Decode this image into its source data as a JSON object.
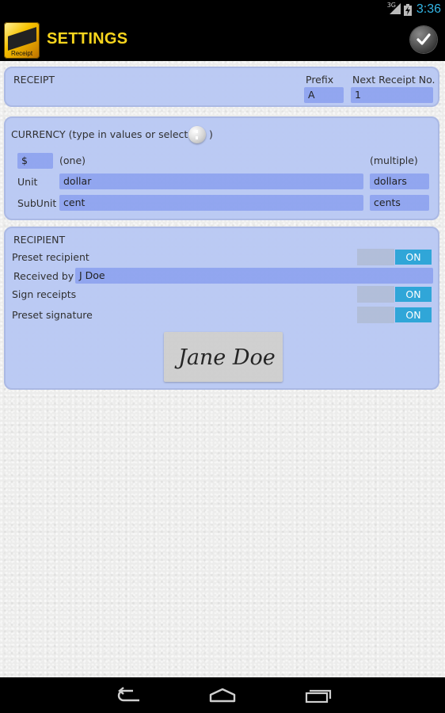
{
  "status_bar": {
    "network_type": "3G",
    "time": "3:36",
    "icons": [
      "signal-icon",
      "battery-charging-icon"
    ]
  },
  "action_bar": {
    "title": "SETTINGS",
    "app_icon_text": "Receipt",
    "done_icon": "check-icon"
  },
  "receipt_section": {
    "heading": "RECEIPT",
    "prefix_label": "Prefix",
    "prefix_value": "A",
    "next_number_label": "Next Receipt No.",
    "next_number_value": "1"
  },
  "currency_section": {
    "heading_prefix": "CURRENCY (type in values or select",
    "heading_suffix": ")",
    "select_icon": "more-options-icon",
    "symbol_value": "$",
    "one_label": "(one)",
    "multiple_label": "(multiple)",
    "unit_label": "Unit",
    "unit_singular": "dollar",
    "unit_plural": "dollars",
    "subunit_label": "SubUnit",
    "subunit_singular": "cent",
    "subunit_plural": "cents"
  },
  "recipient_section": {
    "heading": "RECIPIENT",
    "preset_recipient_label": "Preset recipient",
    "preset_recipient_toggle": "ON",
    "received_by_label": "Received by",
    "received_by_value": "J Doe",
    "sign_receipts_label": "Sign receipts",
    "sign_receipts_toggle": "ON",
    "preset_signature_label": "Preset signature",
    "preset_signature_toggle": "ON",
    "signature_text": "Jane Doe"
  },
  "nav_bar": {
    "icons": [
      "back-icon",
      "home-icon",
      "recent-apps-icon"
    ]
  }
}
